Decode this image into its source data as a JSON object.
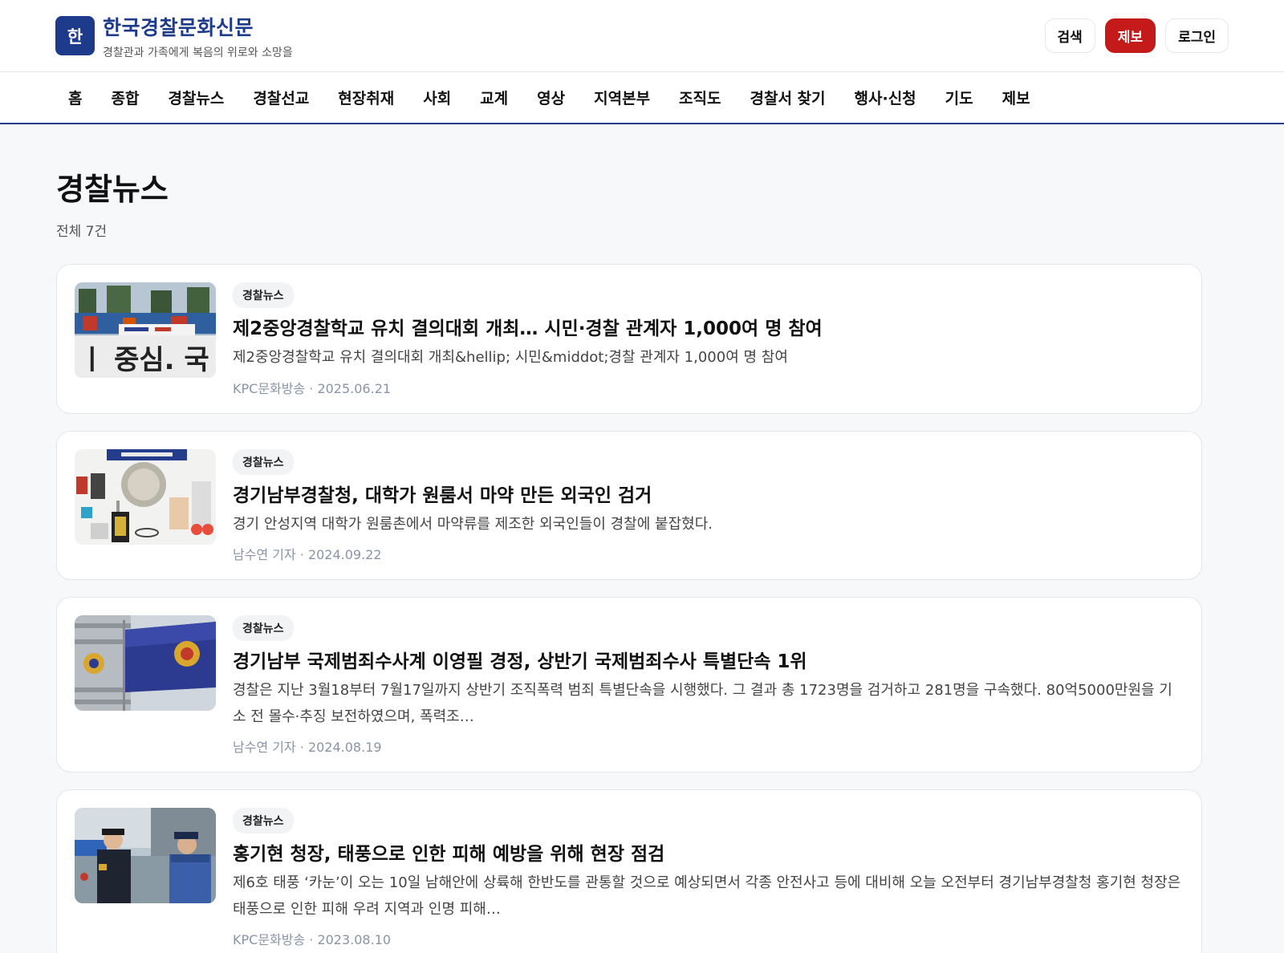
{
  "header": {
    "logo_char": "한",
    "title": "한국경찰문화신문",
    "subtitle": "경찰관과 가족에게 복음의 위로와 소망을",
    "search_label": "검색",
    "report_label": "제보",
    "login_label": "로그인",
    "accent": "#1e3a8a",
    "report_color": "#c41a1a"
  },
  "nav": {
    "items": [
      "홈",
      "종합",
      "경찰뉴스",
      "경찰선교",
      "현장취재",
      "사회",
      "교계",
      "영상",
      "지역본부",
      "조직도",
      "경찰서 찾기",
      "행사·신청",
      "기도",
      "제보"
    ]
  },
  "page": {
    "title": "경찰뉴스",
    "count": "전체 7건"
  },
  "articles": [
    {
      "tag": "경찰뉴스",
      "title": "제2중앙경찰학교 유치 결의대회 개최… 시민·경찰 관계자 1,000여 명 참여",
      "desc": "제2중앙경찰학교 유치 결의대회 개최&hellip; 시민&middot;경찰 관계자 1,000여 명 참여",
      "source": "KPC문화방송",
      "date": "2025.06.21",
      "meta": "KPC문화방송 · 2025.06.21",
      "image": "rally-photo"
    },
    {
      "tag": "경찰뉴스",
      "title": "경기남부경찰청, 대학가 원룸서 마약 만든 외국인 검거",
      "desc": "경기 안성지역 대학가 원룸촌에서 마약류를 제조한 외국인들이 경찰에 붙잡혔다.",
      "source": "남수연 기자",
      "date": "2024.09.22",
      "meta": "남수연 기자 · 2024.09.22",
      "image": "seized-items-photo"
    },
    {
      "tag": "경찰뉴스",
      "title": "경기남부 국제범죄수사계 이영필 경정, 상반기 국제범죄수사 특별단속 1위",
      "desc": "경찰은 지난 3월18부터 7월17일까지 상반기 조직폭력 범죄 특별단속을 시행했다. 그 결과 총 1723명을 검거하고 281명을 구속했다. 80억5000만원을 기소 전 몰수·추징 보전하였으며, 폭력조…",
      "source": "남수연 기자",
      "date": "2024.08.19",
      "meta": "남수연 기자 · 2024.08.19",
      "image": "police-flag-photo"
    },
    {
      "tag": "경찰뉴스",
      "title": "홍기현 청장, 태풍으로 인한 피해 예방을 위해 현장 점검",
      "desc": "제6호 태풍 ‘카눈’이 오는 10일 남해안에 상륙해 한반도를 관통할 것으로 예상되면서 각종 안전사고 등에 대비해 오늘 오전부터 경기남부경찰청 홍기현 청장은 태풍으로 인한 피해 우려 지역과 인명 피해…",
      "source": "KPC문화방송",
      "date": "2023.08.10",
      "meta": "KPC문화방송 · 2023.08.10",
      "image": "officers-inspection-photo"
    }
  ]
}
